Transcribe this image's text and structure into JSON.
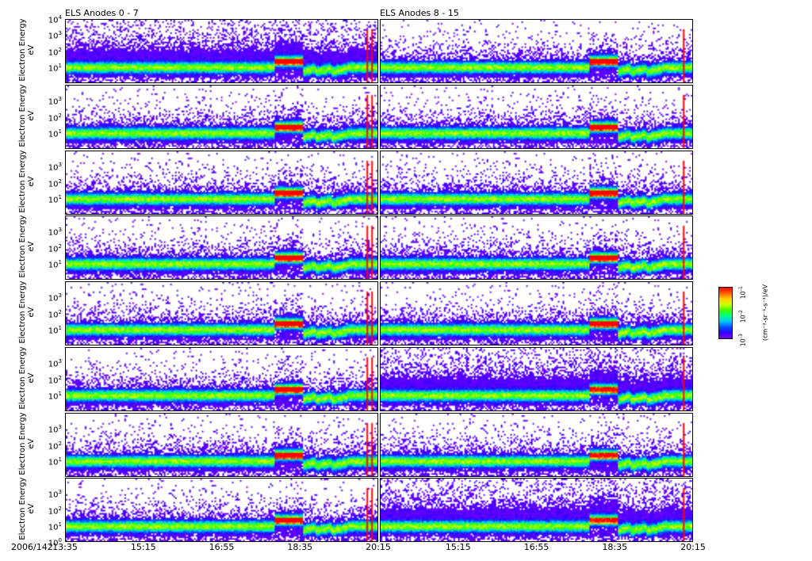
{
  "chart_data": {
    "type": "heatmap",
    "date_label": "2006/142",
    "columns": [
      {
        "title": "ELS Anodes 0 - 7",
        "red_marker_times": [
          "20:00",
          "20:07"
        ]
      },
      {
        "title": "ELS Anodes 8 - 15",
        "red_marker_times": [
          "20:02"
        ]
      }
    ],
    "rows": 8,
    "ylabel": "Electron Energy",
    "yunit": "eV",
    "yscale": "log",
    "ylim": [
      1,
      10000
    ],
    "yticks_top": [
      "4",
      "3",
      "2",
      "1"
    ],
    "yticks": [
      "3",
      "2",
      "1"
    ],
    "yticks_bottom": [
      "3",
      "2",
      "1",
      "0"
    ],
    "xlim": [
      "13:35",
      "20:15"
    ],
    "xticks_left": [
      "13:35",
      "15:15",
      "16:55",
      "18:35",
      "20:15"
    ],
    "xticks_right": [
      "13:35",
      "15:15",
      "16:55",
      "18:35",
      "20:15"
    ],
    "colorbar": {
      "ticks": [
        "-1",
        "-2",
        "-3"
      ],
      "label": "(cm⁻²-sr⁻¹-s⁻¹)/eV",
      "colormap": "rainbow"
    },
    "features": {
      "band_center_eV": 10,
      "heated_interval": [
        "18:15",
        "18:50"
      ],
      "heated_center_eV": 30,
      "low_interval": [
        "18:50",
        "19:45"
      ],
      "low_center_eV": 5
    }
  }
}
